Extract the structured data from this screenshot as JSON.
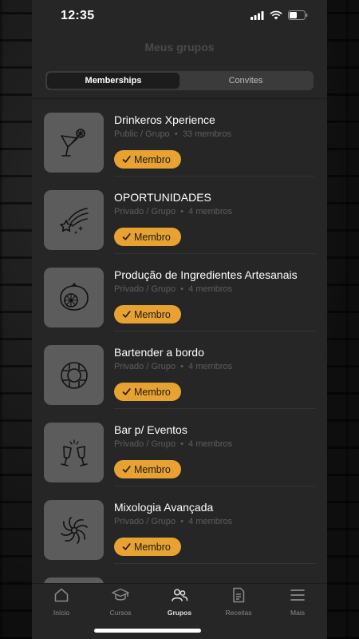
{
  "status_bar": {
    "time": "12:35"
  },
  "header": {
    "title": "Meus grupos"
  },
  "tabs": [
    {
      "label": "Memberships",
      "active": true
    },
    {
      "label": "Convites",
      "active": false
    }
  ],
  "groups": [
    {
      "name": "Drinkeros Xperience",
      "visibility": "Public / Grupo",
      "separator": "•",
      "members": "33 membros",
      "badge": "Membro",
      "icon": "cocktail-glass-icon"
    },
    {
      "name": "OPORTUNIDADES",
      "visibility": "Privado / Grupo",
      "separator": "•",
      "members": "4 membros",
      "badge": "Membro",
      "icon": "shooting-star-icon"
    },
    {
      "name": "Produção de Ingredientes Artesanais",
      "visibility": "Privado / Grupo",
      "separator": "•",
      "members": "4 membros",
      "badge": "Membro",
      "icon": "lemon-slice-icon"
    },
    {
      "name": "Bartender a bordo",
      "visibility": "Privado / Grupo",
      "separator": "•",
      "members": "4 membros",
      "badge": "Membro",
      "icon": "lifebuoy-icon"
    },
    {
      "name": "Bar p/ Eventos",
      "visibility": "Privado / Grupo",
      "separator": "•",
      "members": "4 membros",
      "badge": "Membro",
      "icon": "champagne-toast-icon"
    },
    {
      "name": "Mixologia Avançada",
      "visibility": "Privado / Grupo",
      "separator": "•",
      "members": "4 membros",
      "badge": "Membro",
      "icon": "swirl-icon"
    }
  ],
  "bottom_nav": [
    {
      "label": "Início",
      "icon": "home-icon",
      "active": false
    },
    {
      "label": "Cursos",
      "icon": "graduation-cap-icon",
      "active": false
    },
    {
      "label": "Grupos",
      "icon": "users-icon",
      "active": true
    },
    {
      "label": "Receitas",
      "icon": "document-icon",
      "active": false
    },
    {
      "label": "Mais",
      "icon": "menu-icon",
      "active": false
    }
  ],
  "colors": {
    "accent": "#e8a232",
    "background": "#262626",
    "thumb": "#5c5c5c"
  }
}
